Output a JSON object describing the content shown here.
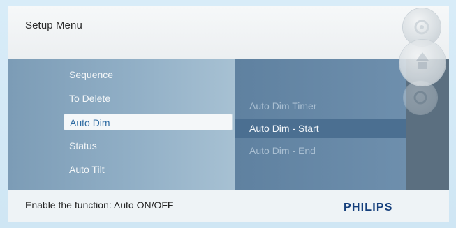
{
  "header": {
    "title": "Setup Menu"
  },
  "menu": {
    "left_items": [
      {
        "label": "Sequence",
        "selected": false
      },
      {
        "label": "To Delete",
        "selected": false
      },
      {
        "label": "Auto Dim",
        "selected": true
      },
      {
        "label": "Status",
        "selected": false
      },
      {
        "label": "Auto Tilt",
        "selected": false
      }
    ],
    "right_items": [
      {
        "label": "Auto Dim Timer",
        "state": "dim"
      },
      {
        "label": "Auto Dim - Start",
        "state": "selected"
      },
      {
        "label": "Auto Dim - End",
        "state": "dim"
      }
    ]
  },
  "footer": {
    "hint": "Enable the function: Auto ON/OFF",
    "brand": "PHILIPS"
  },
  "controls": {
    "icons": [
      "dial-top-icon",
      "dial-middle-icon",
      "dial-bottom-icon"
    ]
  },
  "colors": {
    "accent_text": "#2c6aa1",
    "brand": "#153f7c",
    "menu_bg": "#7f9fb8",
    "submenu_bg": "#5f81a0"
  }
}
